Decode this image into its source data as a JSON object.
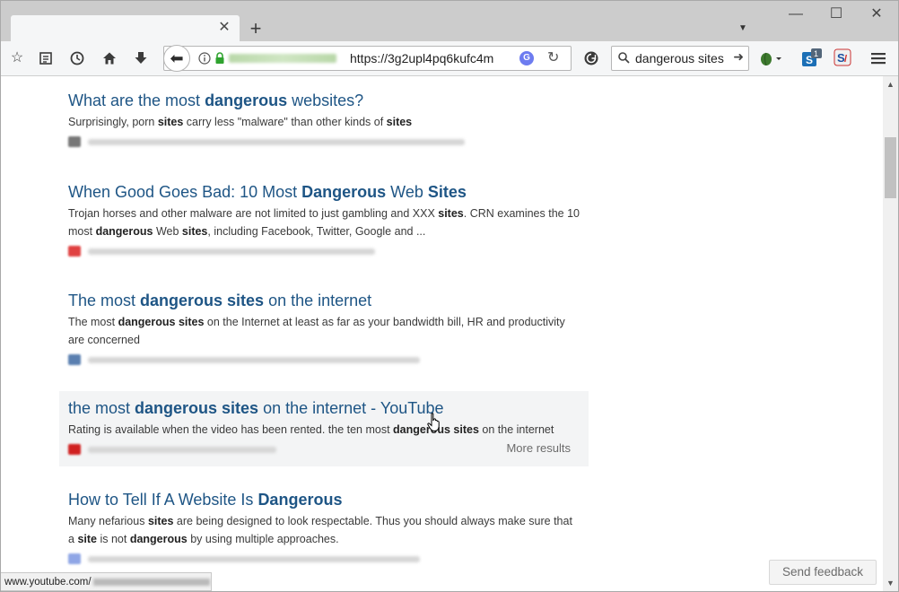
{
  "browser": {
    "url": "https://3g2upl4pq6kufc4m",
    "search_query": "dangerous sites",
    "new_tab_label": "+",
    "tab_close": "✕",
    "window_minimize": "—",
    "window_maximize": "☐",
    "window_close": "✕",
    "identity_icon": "info-icon",
    "addon_badge_count": "1"
  },
  "results": [
    {
      "title_parts": [
        "What are the most ",
        "dangerous",
        " websites?"
      ],
      "snippet_parts": [
        "Surprisingly, porn ",
        "sites",
        " carry less \"malware\" than other kinds of ",
        "sites"
      ]
    },
    {
      "title_parts": [
        "When Good Goes Bad: 10 Most ",
        "Dangerous",
        " Web ",
        "Sites"
      ],
      "snippet_parts": [
        "Trojan horses and other malware are not limited to just gambling and XXX ",
        "sites",
        ". CRN examines the 10 most ",
        "dangerous",
        " Web ",
        "sites",
        ", including Facebook, Twitter, Google and ..."
      ]
    },
    {
      "title_parts": [
        "The most ",
        "dangerous sites",
        " on the internet"
      ],
      "snippet_parts": [
        "The most ",
        "dangerous sites",
        " on the Internet at least as far as your bandwidth bill, HR and productivity are concerned"
      ]
    },
    {
      "title_parts": [
        "the most ",
        "dangerous sites",
        " on the internet - YouTube"
      ],
      "snippet_parts": [
        "Rating is available when the video has been rented. the ten most ",
        "dangerous sites",
        " on the internet"
      ],
      "more_label": "More results"
    },
    {
      "title_parts": [
        "How to Tell If A Website Is ",
        "Dangerous"
      ],
      "snippet_parts": [
        "Many nefarious ",
        "sites",
        " are being designed to look respectable. Thus you should always make sure that a ",
        "site",
        " is not ",
        "dangerous",
        " by using multiple approaches."
      ]
    }
  ],
  "status_bar": {
    "url": "www.youtube.com/"
  },
  "feedback_label": "Send feedback"
}
